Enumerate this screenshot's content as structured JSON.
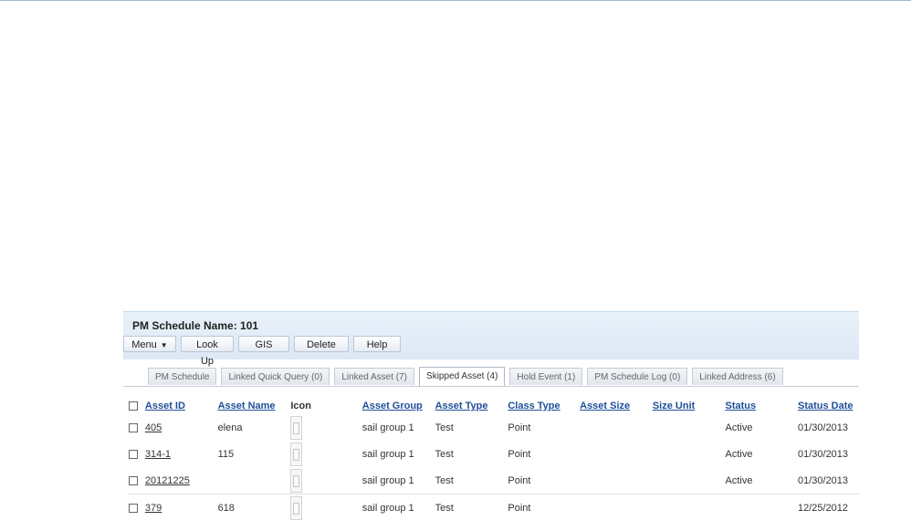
{
  "header": {
    "title": "PM Schedule Name: 101"
  },
  "toolbar": {
    "menu_label": "Menu",
    "lookup_label": "Look Up",
    "gis_label": "GIS",
    "delete_label": "Delete",
    "help_label": "Help"
  },
  "tabs": [
    {
      "label": "PM Schedule"
    },
    {
      "label": "Linked Quick Query (0)"
    },
    {
      "label": "Linked Asset (7)"
    },
    {
      "label": "Skipped Asset (4)"
    },
    {
      "label": "Hold Event (1)"
    },
    {
      "label": "PM Schedule Log (0)"
    },
    {
      "label": "Linked Address (6)"
    }
  ],
  "active_tab": "Skipped Asset (4)",
  "table": {
    "columns": [
      "Asset ID",
      "Asset Name",
      "Icon",
      "Asset Group",
      "Asset Type",
      "Class Type",
      "Asset Size",
      "Size Unit",
      "Status",
      "Status Date"
    ],
    "rows": [
      {
        "asset_id": "405",
        "asset_name": "elena",
        "asset_group": "sail group 1",
        "asset_type": "Test",
        "class_type": "Point",
        "asset_size": "",
        "size_unit": "",
        "status": "Active",
        "status_date": "01/30/2013"
      },
      {
        "asset_id": "314-1",
        "asset_name": "115",
        "asset_group": "sail group 1",
        "asset_type": "Test",
        "class_type": "Point",
        "asset_size": "",
        "size_unit": "",
        "status": "Active",
        "status_date": "01/30/2013"
      },
      {
        "asset_id": "20121225",
        "asset_name": "",
        "asset_group": "sail group 1",
        "asset_type": "Test",
        "class_type": "Point",
        "asset_size": "",
        "size_unit": "",
        "status": "Active",
        "status_date": "01/30/2013"
      },
      {
        "asset_id": "379",
        "asset_name": "618",
        "asset_group": "sail group 1",
        "asset_type": "Test",
        "class_type": "Point",
        "asset_size": "",
        "size_unit": "",
        "status": "",
        "status_date": "12/25/2012"
      }
    ]
  }
}
